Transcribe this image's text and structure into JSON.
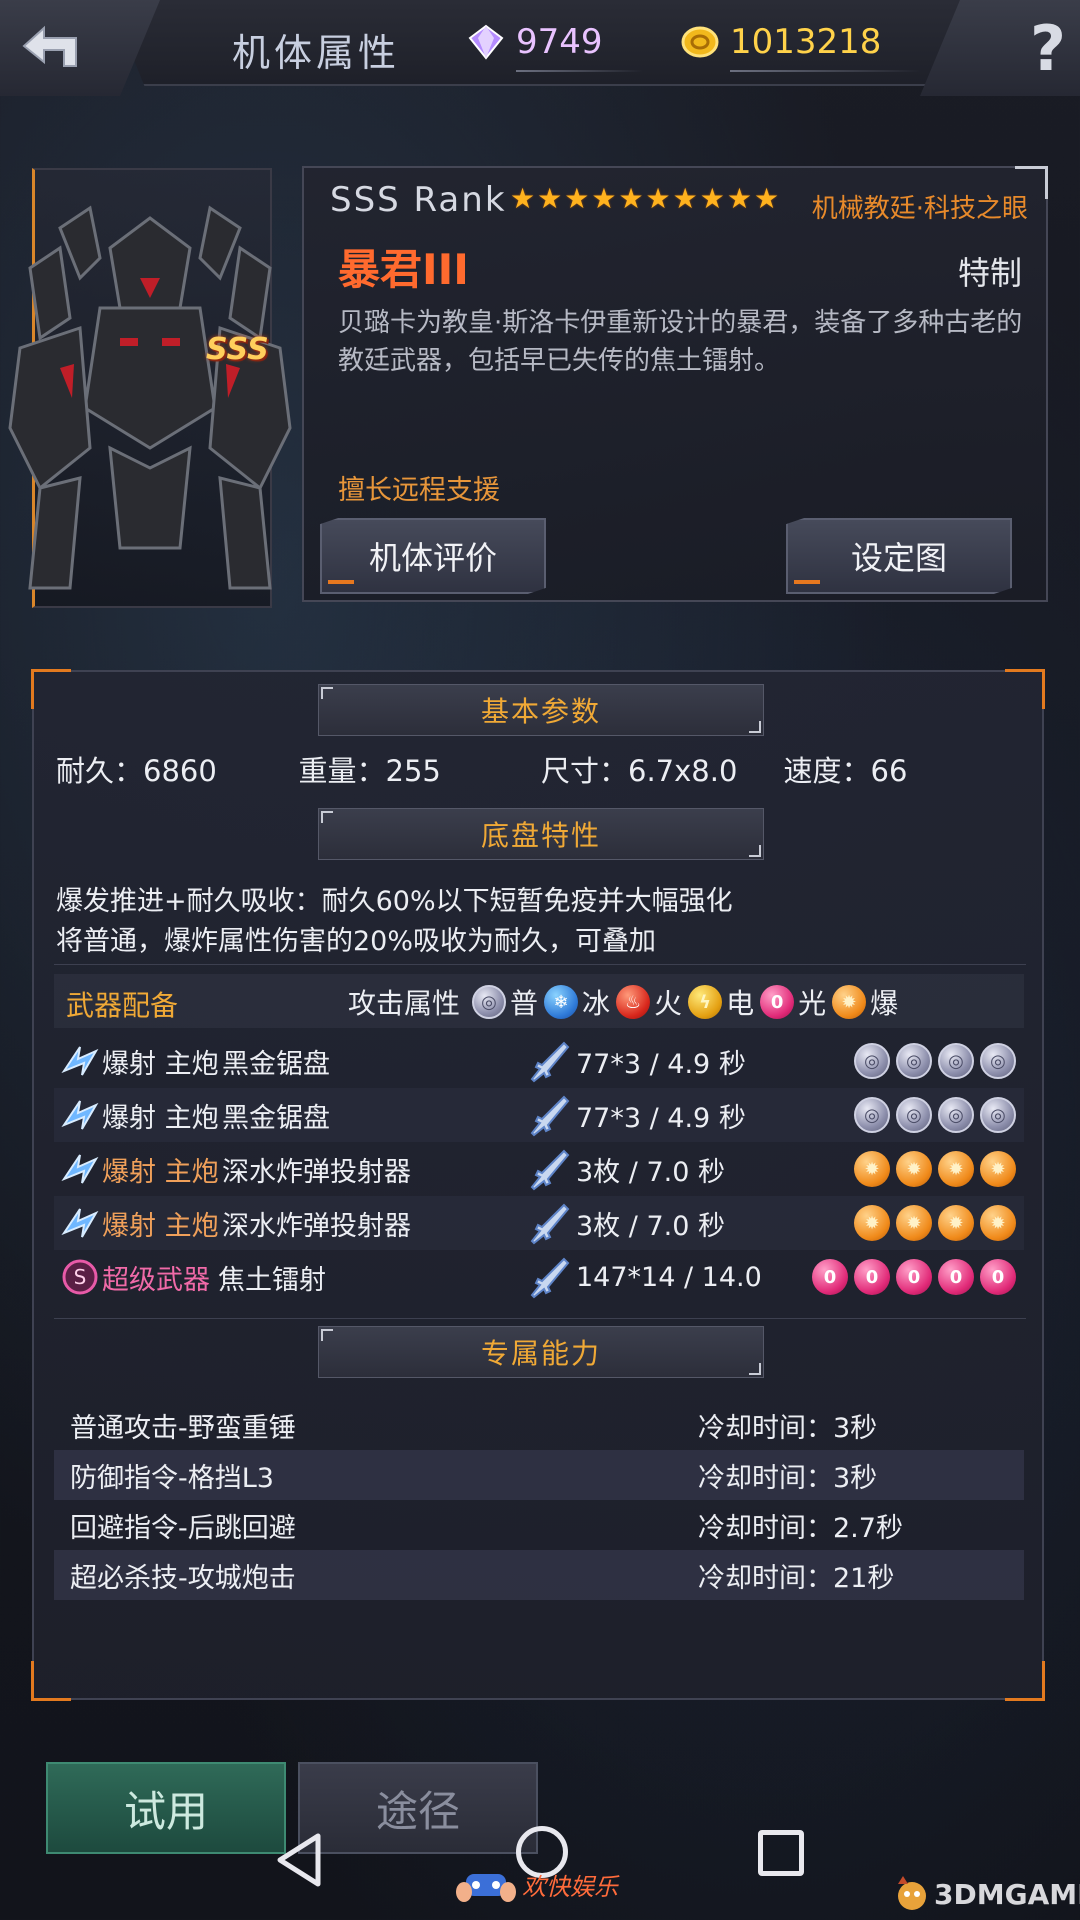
{
  "topbar": {
    "title": "机体属性",
    "gems": "9749",
    "gold": "1013218"
  },
  "mech": {
    "rank_badge": "SSS",
    "rank_text": "SSS  Rank",
    "stars": [
      "★",
      "★",
      "★",
      "★",
      "★",
      "★",
      "★",
      "★",
      "★",
      "★"
    ],
    "faction": "机械教廷·科技之眼",
    "name": "暴君III",
    "type": "特制",
    "description": "贝璐卡为教皇·斯洛卡伊重新设计的暴君，装备了多种古老的教廷武器，包括早已失传的焦土镭射。",
    "specialty": "擅长远程支援",
    "btn_eval": "机体评价",
    "btn_setting": "设定图"
  },
  "basic": {
    "header": "基本参数",
    "durability": "耐久：6860",
    "weight": "重量：255",
    "size": "尺寸：6.7x8.0",
    "speed": "速度：66"
  },
  "chassis": {
    "header": "底盘特性",
    "line1": "爆发推进+耐久吸收：耐久60%以下短暂免疫并大幅强化",
    "line2": "将普通，爆炸属性伤害的20%吸收为耐久，可叠加"
  },
  "weapons": {
    "header": "武器配备",
    "attr_label": "攻击属性",
    "legend": [
      {
        "type": "normal",
        "label": "普"
      },
      {
        "type": "ice",
        "label": "冰"
      },
      {
        "type": "fire",
        "label": "火"
      },
      {
        "type": "elec",
        "label": "电"
      },
      {
        "type": "light",
        "label": "光"
      },
      {
        "type": "blast",
        "label": "爆"
      }
    ],
    "rows": [
      {
        "cat": "爆射 主炮",
        "name": "黑金锯盘",
        "dmg": "77*3  / 4.9 秒",
        "slot_type": "normal",
        "slots": 4,
        "cat_color": "white"
      },
      {
        "cat": "爆射 主炮",
        "name": "黑金锯盘",
        "dmg": "77*3  / 4.9 秒",
        "slot_type": "normal",
        "slots": 4,
        "cat_color": "white"
      },
      {
        "cat": "爆射 主炮",
        "name": "深水炸弹投射器",
        "dmg": "3枚  / 7.0 秒",
        "slot_type": "blast",
        "slots": 4,
        "cat_color": "orange"
      },
      {
        "cat": "爆射 主炮",
        "name": "深水炸弹投射器",
        "dmg": "3枚  / 7.0 秒",
        "slot_type": "blast",
        "slots": 4,
        "cat_color": "orange"
      },
      {
        "cat": "超级武器",
        "name": "焦土镭射",
        "dmg": "147*14  / 14.0",
        "slot_type": "light",
        "slots": 5,
        "cat_color": "pink"
      }
    ]
  },
  "abilities": {
    "header": "专属能力",
    "rows": [
      {
        "name": "普通攻击-野蛮重锤",
        "cd": "冷却时间：3秒"
      },
      {
        "name": "防御指令-格挡L3",
        "cd": "冷却时间：3秒"
      },
      {
        "name": "回避指令-后跳回避",
        "cd": "冷却时间：2.7秒"
      },
      {
        "name": "超必杀技-攻城炮击",
        "cd": "冷却时间：21秒"
      }
    ]
  },
  "bottom": {
    "try_label": "试用",
    "route_label": "途径"
  },
  "watermarks": {
    "left": "欢快娱乐",
    "right": "3DMGAME"
  },
  "colors": {
    "accent_orange": "#e37a1f",
    "name_red": "#ff6a2e",
    "header_gold": "#f0a936",
    "gold_text": "#ffd24a"
  }
}
